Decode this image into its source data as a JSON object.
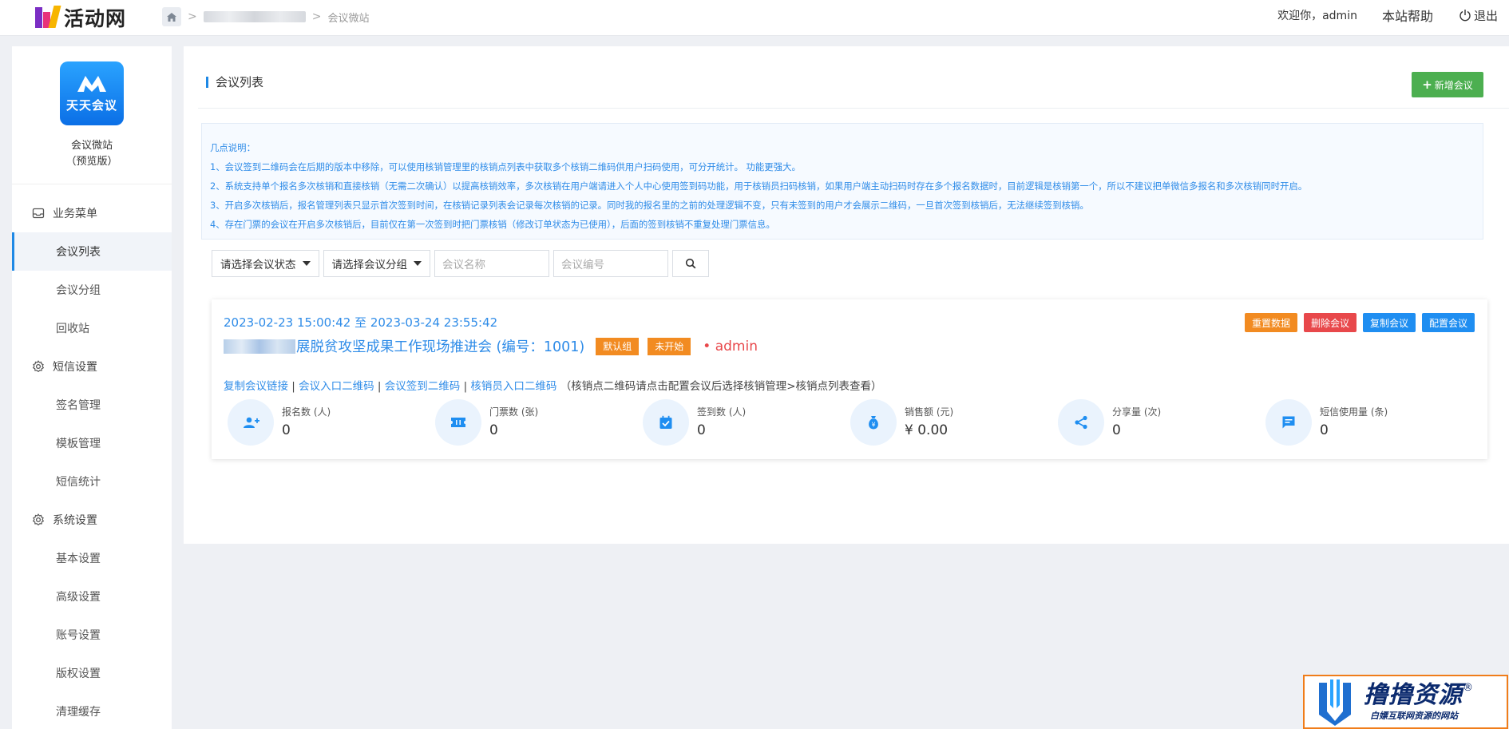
{
  "brand": {
    "name": "活动网"
  },
  "breadcrumb": {
    "current": "会议微站"
  },
  "topbar": {
    "welcome": "欢迎你，admin",
    "help": "本站帮助",
    "logout": "退出"
  },
  "sidebar": {
    "app_icon_text": "天天会议",
    "site_title": "会议微站",
    "site_subtitle": "（预览版）",
    "groups": [
      {
        "label": "业务菜单",
        "icon": "inbox-icon",
        "items": [
          "会议列表",
          "会议分组",
          "回收站"
        ]
      },
      {
        "label": "短信设置",
        "icon": "gear-icon",
        "items": [
          "签名管理",
          "模板管理",
          "短信统计"
        ]
      },
      {
        "label": "系统设置",
        "icon": "gear-icon",
        "items": [
          "基本设置",
          "高级设置",
          "账号设置",
          "版权设置",
          "清理缓存"
        ]
      }
    ]
  },
  "panel": {
    "title": "会议列表",
    "add_button": "新增会议",
    "notice": {
      "heading": "几点说明：",
      "lines": [
        "1、会议签到二维码会在后期的版本中移除，可以使用核销管理里的核销点列表中获取多个核销二维码供用户扫码使用，可分开统计。 功能更强大。",
        "2、系统支持单个报名多次核销和直接核销（无需二次确认）以提高核销效率，多次核销在用户端请进入个人中心使用签到码功能，用于核销员扫码核销，如果用户端主动扫码时存在多个报名数据时，目前逻辑是核销第一个，所以不建议把单微信多报名和多次核销同时开启。",
        "3、开启多次核销后，报名管理列表只显示首次签到时间，在核销记录列表会记录每次核销的记录。同时我的报名里的之前的处理逻辑不变，只有未签到的用户才会展示二维码，一旦首次签到核销后，无法继续签到核销。",
        "4、存在门票的会议在开启多次核销后，目前仅在第一次签到时把门票核销（修改订单状态为已使用），后面的签到核销不重复处理门票信息。"
      ]
    },
    "filters": {
      "status_select": "请选择会议状态",
      "group_select": "请选择会议分组",
      "name_placeholder": "会议名称",
      "code_placeholder": "会议编号"
    }
  },
  "meeting": {
    "date_range": "2023-02-23 15:00:42 至 2023-03-24 23:55:42",
    "title": "展脱贫攻坚成果工作现场推进会 (编号：1001)",
    "group_tag": "默认组",
    "status_tag": "未开始",
    "owner": "• admin",
    "actions": {
      "reset": "重置数据",
      "delete": "删除会议",
      "copy": "复制会议",
      "config": "配置会议"
    },
    "links": {
      "copy_link": "复制会议链接",
      "entry_qr": "会议入口二维码",
      "checkin_qr": "会议签到二维码",
      "staff_qr": "核销员入口二维码",
      "hint": "（核销点二维码请点击配置会议后选择核销管理>核销点列表查看）"
    },
    "stats": [
      {
        "label": "报名数 (人)",
        "value": "0",
        "icon": "users-icon"
      },
      {
        "label": "门票数 (张)",
        "value": "0",
        "icon": "ticket-icon"
      },
      {
        "label": "签到数 (人)",
        "value": "0",
        "icon": "calendar-check-icon"
      },
      {
        "label": "销售额 (元)",
        "value": "¥ 0.00",
        "icon": "money-bag-icon"
      },
      {
        "label": "分享量 (次)",
        "value": "0",
        "icon": "share-icon"
      },
      {
        "label": "短信使用量 (条)",
        "value": "0",
        "icon": "message-icon"
      }
    ]
  },
  "watermark": {
    "title": "撸撸资源",
    "reg": "®",
    "subtitle": "白嫖互联网资源的网站"
  },
  "colors": {
    "accent": "#1e88e5",
    "link": "#2f8ce8",
    "success": "#4caf50",
    "warning": "#f28b21",
    "danger": "#e8484b"
  }
}
